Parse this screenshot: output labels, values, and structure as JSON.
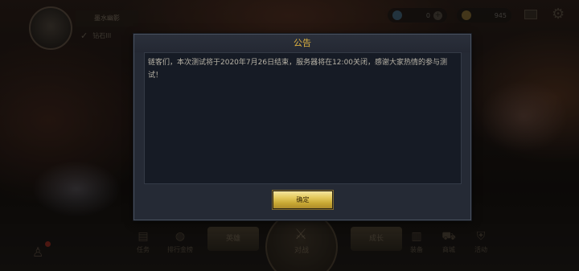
{
  "background": {
    "player_name": "墨水幽影",
    "rank_label": "钻石III",
    "diamond_value": "0",
    "gold_value": "945",
    "nav": [
      {
        "icon": "task-icon",
        "label": "任务"
      },
      {
        "icon": "globe-icon",
        "label": "排行金榜"
      },
      {
        "icon": "bag-icon",
        "label": "装备"
      },
      {
        "icon": "shop-icon",
        "label": "商城"
      },
      {
        "icon": "shield-icon",
        "label": "活动"
      }
    ],
    "left_plate": "英雄",
    "right_plate": "成长",
    "battle_label": "对战"
  },
  "dialog": {
    "title": "公告",
    "content": "链客们，本次测试将于2020年7月26日结束，服务器将在12:00关闭，感谢大家热情的参与测试！",
    "confirm_label": "确定"
  },
  "colors": {
    "title": "#e0b441",
    "panel": "#252a35",
    "content_bg": "#161b25",
    "button_gold": "#e3c95c"
  }
}
